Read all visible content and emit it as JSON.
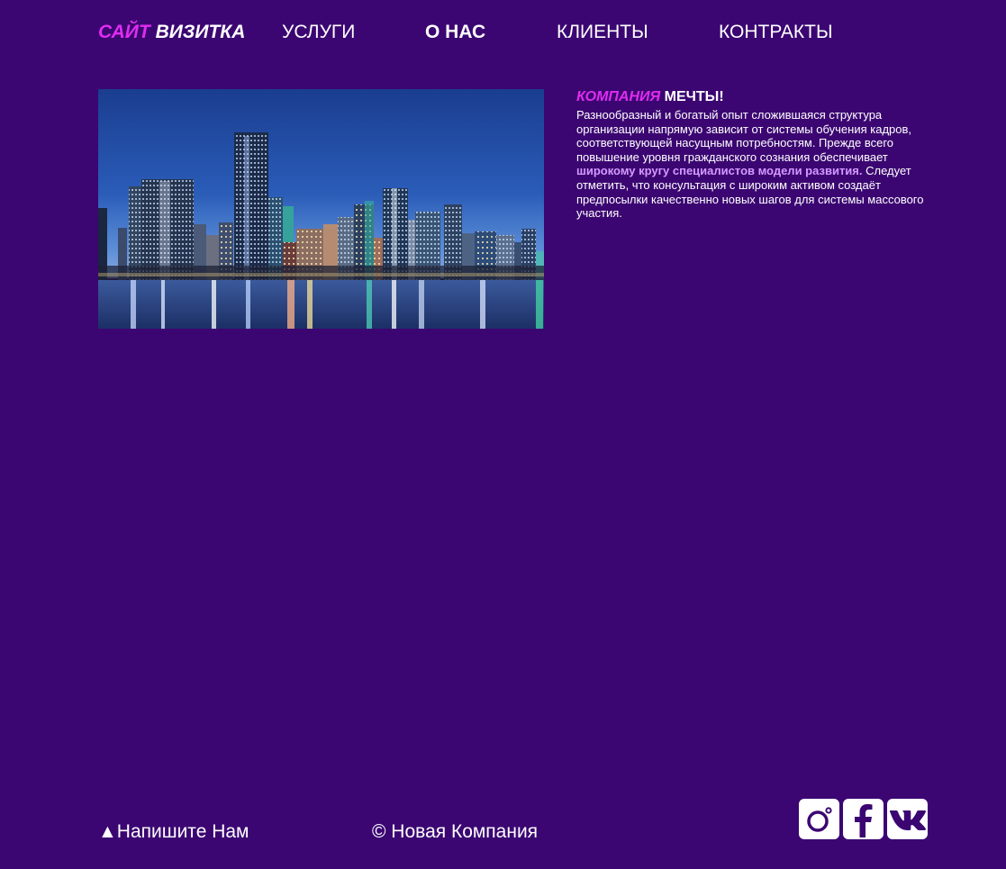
{
  "header": {
    "logo": {
      "part1": "САЙТ",
      "part2": "ВИЗИТКА"
    },
    "nav": [
      {
        "label": "УСЛУГИ",
        "active": false
      },
      {
        "label": "О НАС",
        "active": true
      },
      {
        "label": "КЛИЕНТЫ",
        "active": false
      },
      {
        "label": "КОНТРАКТЫ",
        "active": false
      }
    ]
  },
  "about": {
    "title_accent": "КОМПАНИЯ",
    "title_rest": "МЕЧТЫ!",
    "text_before": "Разнообразный и богатый опыт сложившаяся структура организации напрямую зависит от системы обучения кадров, соответствующей насущным потребностям. Прежде всего повышение уровня гражданского сознания обеспечивает ",
    "text_highlight": "широкому кругу специалистов модели развития.",
    "text_after": " Следует отметить, что консультация с широким активом создаёт предпосылки качественно новых шагов для системы массового участия."
  },
  "footer": {
    "contact_label": "▲Напишите Нам",
    "copyright": "© Новая Компания",
    "socials": [
      "instagram-icon",
      "facebook-icon",
      "vk-icon"
    ]
  },
  "colors": {
    "background": "#3b0672",
    "accent": "#e02cf0",
    "highlight": "#d49aff",
    "text": "#ffffff"
  }
}
